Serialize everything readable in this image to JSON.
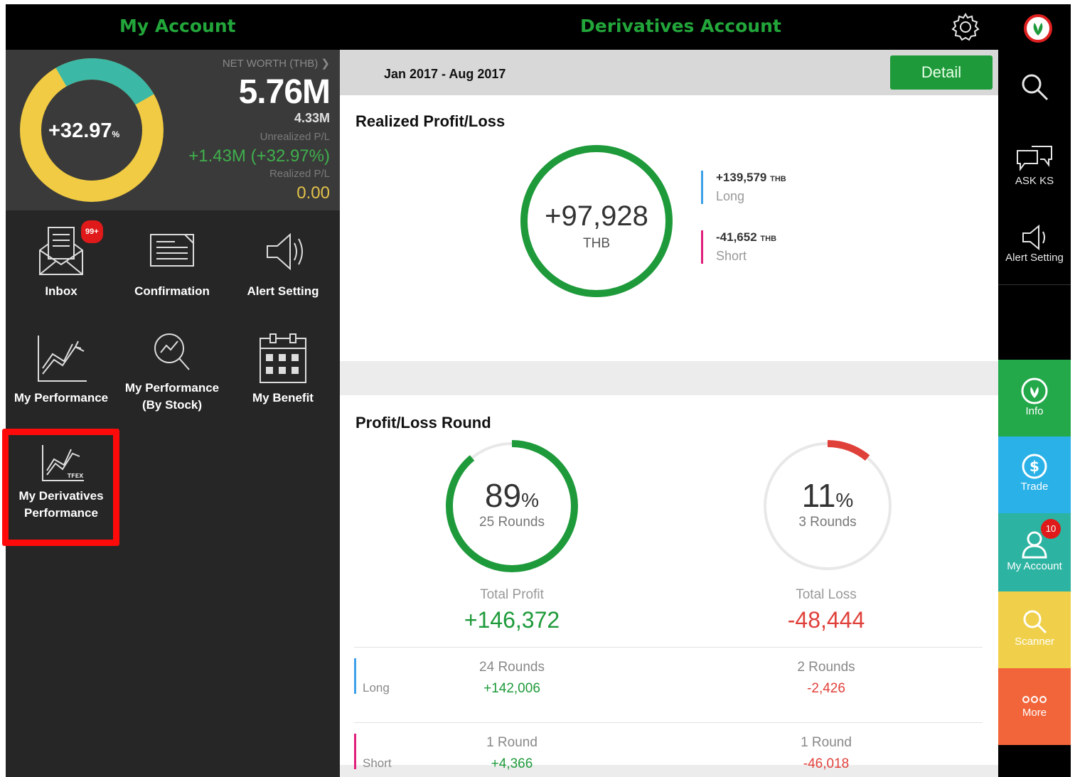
{
  "header": {
    "left_title": "My Account",
    "center_title": "Derivatives Account",
    "settings_icon": "gear-icon",
    "logo_icon": "kasikorn-logo"
  },
  "summary": {
    "donut_percent": "+32.97",
    "donut_percent_unit": "%",
    "donut_fraction": 0.2497,
    "net_worth_label": "NET WORTH (THB)",
    "net_worth_value": "5.76M",
    "net_worth_sub": "4.33M",
    "unrealized_label": "Unrealized P/L",
    "unrealized_value": "+1.43M (+32.97%)",
    "realized_label": "Realized P/L",
    "realized_value": "0.00",
    "colors": {
      "teal": "#3bb8a6",
      "yellow": "#f1cb43"
    }
  },
  "menu": {
    "items": [
      {
        "label": "Inbox",
        "icon": "inbox-icon",
        "badge": "99+"
      },
      {
        "label": "Confirmation",
        "icon": "document-icon"
      },
      {
        "label": "Alert Setting",
        "icon": "megaphone-icon"
      },
      {
        "label": "My Performance",
        "icon": "line-chart-icon"
      },
      {
        "label_line1": "My Performance",
        "label_line2": "(By Stock)",
        "icon": "search-chart-icon"
      },
      {
        "label": "My Benefit",
        "icon": "calendar-icon"
      },
      {
        "label_line1": "My Derivatives",
        "label_line2": "Performance",
        "icon": "derivatives-chart-icon",
        "icon_caption": "TFEX"
      }
    ]
  },
  "main": {
    "date_range": "Jan 2017 - Aug 2017",
    "detail_button": "Detail",
    "realized": {
      "title": "Realized Profit/Loss",
      "value": "+97,928",
      "unit": "THB",
      "long_value": "+139,579",
      "long_unit": "THB",
      "long_label": "Long",
      "short_value": "-41,652",
      "short_unit": "THB",
      "short_label": "Short"
    },
    "rounds": {
      "title": "Profit/Loss Round",
      "profit_pct": "89",
      "profit_fraction": 0.89,
      "profit_rounds": "25 Rounds",
      "profit_label": "Total Profit",
      "profit_value": "+146,372",
      "loss_pct": "11",
      "loss_fraction": 0.11,
      "loss_rounds": "3 Rounds",
      "loss_label": "Total Loss",
      "loss_value": "-48,444",
      "pct_unit": "%",
      "long_label": "Long",
      "long_profit_rounds": "24 Rounds",
      "long_profit_value": "+142,006",
      "long_loss_rounds": "2 Rounds",
      "long_loss_value": "-2,426",
      "short_label": "Short",
      "short_profit_rounds": "1 Round",
      "short_profit_value": "+4,366",
      "short_loss_rounds": "1 Round",
      "short_loss_value": "-46,018"
    },
    "colors": {
      "green": "#1e9a3a",
      "red": "#e0403a",
      "long": "#3ea1e8",
      "short": "#e0207a"
    }
  },
  "sidebar": {
    "search_icon": "search-icon",
    "ask_label": "ASK KS",
    "alert_label": "Alert Setting",
    "info_label": "Info",
    "trade_label": "Trade",
    "account_label": "My Account",
    "account_badge": "10",
    "scanner_label": "Scanner",
    "more_label": "More",
    "colors": {
      "info": "#23a84a",
      "trade": "#2ab1e8",
      "account": "#2cb3a1",
      "scanner": "#f0d04a",
      "more": "#f2653a"
    }
  }
}
